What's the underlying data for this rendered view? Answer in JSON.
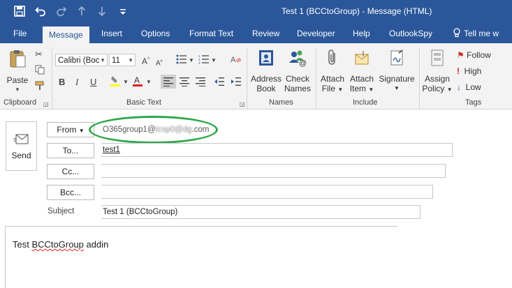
{
  "window": {
    "title": "Test 1 (BCCtoGroup)  -  Message (HTML)"
  },
  "quick_access": {
    "save_icon": "save-icon",
    "undo_icon": "undo-icon",
    "redo_icon": "redo-icon",
    "up_icon": "arrow-up-icon",
    "down_icon": "arrow-down-icon",
    "customize_icon": "customize-qat-icon"
  },
  "tabs": [
    {
      "label": "File"
    },
    {
      "label": "Message",
      "active": true
    },
    {
      "label": "Insert"
    },
    {
      "label": "Options"
    },
    {
      "label": "Format Text"
    },
    {
      "label": "Review"
    },
    {
      "label": "Developer"
    },
    {
      "label": "Help"
    },
    {
      "label": "OutlookSpy"
    },
    {
      "label": "Tell me w"
    }
  ],
  "ribbon": {
    "clipboard": {
      "label": "Clipboard",
      "paste": "Paste"
    },
    "basic_text": {
      "label": "Basic Text",
      "font_name": "Calibri (Boc",
      "font_size": "11"
    },
    "names": {
      "label": "Names",
      "address_book_1": "Address",
      "address_book_2": "Book",
      "check_names_1": "Check",
      "check_names_2": "Names"
    },
    "include": {
      "label": "Include",
      "attach_file_1": "Attach",
      "attach_file_2": "File",
      "attach_item_1": "Attach",
      "attach_item_2": "Item",
      "signature": "Signature"
    },
    "tags": {
      "label": "Tags",
      "assign_policy_1": "Assign",
      "assign_policy_2": "Policy",
      "follow": "Follow",
      "high": "High",
      "low": "Low"
    }
  },
  "compose": {
    "send": "Send",
    "from_button": "From",
    "from_value": "O365group1@",
    "from_value_obscured": "tcsp0@dg",
    "from_value_suffix": ".com",
    "to_button": "To...",
    "to_value": "test1",
    "cc_button": "Cc...",
    "cc_value": "",
    "bcc_button": "Bcc...",
    "bcc_value": "",
    "subject_label": "Subject",
    "subject_value": "Test 1 (BCCtoGroup)",
    "body_prefix": "Test ",
    "body_misspelled": "BCCtoGroup",
    "body_suffix": " addin"
  },
  "colors": {
    "accent": "#2b579a",
    "highlight_oval": "#2ea84a",
    "ribbon_bg": "#f3f3f3"
  }
}
